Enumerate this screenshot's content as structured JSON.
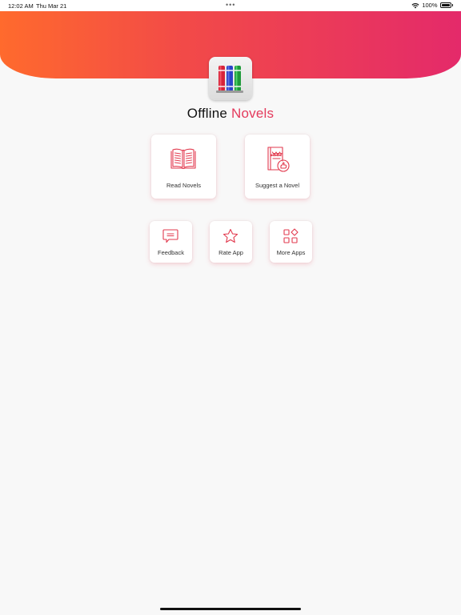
{
  "status_bar": {
    "time": "12:02 AM",
    "date": "Thu Mar 21",
    "dots": "•••",
    "battery": "100%",
    "icons": [
      "wifi-icon",
      "battery-icon"
    ]
  },
  "app": {
    "title_part1": "Offline",
    "title_part2": "Novels",
    "logo_icon": "books-logo-icon",
    "accent_color": "#e43a5c",
    "gradient": [
      "#ff6a2d",
      "#e42a6a"
    ]
  },
  "menu": {
    "read_novels": "Read Novels",
    "suggest_novel": "Suggest a Novel",
    "feedback": "Feedback",
    "rate_app": "Rate App",
    "more_apps": "More Apps"
  }
}
